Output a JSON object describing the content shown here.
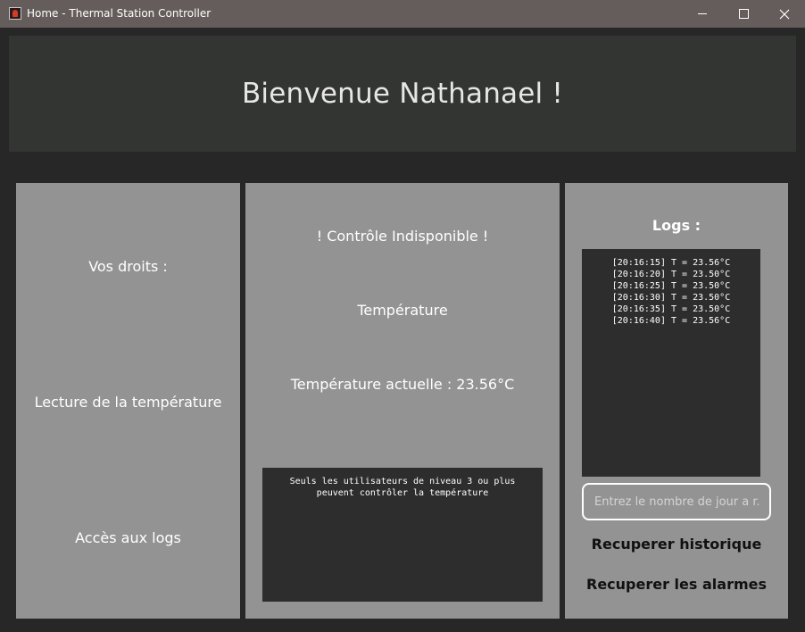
{
  "window": {
    "title": "Home - Thermal Station Controller",
    "icon": "app-thermometer-icon"
  },
  "header": {
    "welcome": "Bienvenue Nathanael !"
  },
  "rights_panel": {
    "title": "Vos droits :",
    "items": [
      "Lecture de la température",
      "Accès aux logs"
    ]
  },
  "control_panel": {
    "status": "! Contrôle Indisponible !",
    "section_title": "Température",
    "current_temp": "Température actuelle : 23.56°C",
    "message_lines": [
      "Seuls les utilisateurs de niveau 3 ou plus",
      "peuvent contrôler la température"
    ]
  },
  "logs_panel": {
    "title": "Logs :",
    "entries": [
      "[20:16:15] T = 23.56°C",
      "[20:16:20] T = 23.50°C",
      "[20:16:25] T = 23.50°C",
      "[20:16:30] T = 23.50°C",
      "[20:16:35] T = 23.50°C",
      "[20:16:40] T = 23.56°C"
    ],
    "days_input": {
      "placeholder": "Entrez le nombre de jour a r...",
      "value": ""
    },
    "history_button": "Recuperer historique",
    "alarms_button": "Recuperer les alarmes"
  },
  "colors": {
    "titlebar": "#645d5b",
    "background": "#272727",
    "header": "#333532",
    "panel": "#939393",
    "box": "#2d2d2d"
  }
}
